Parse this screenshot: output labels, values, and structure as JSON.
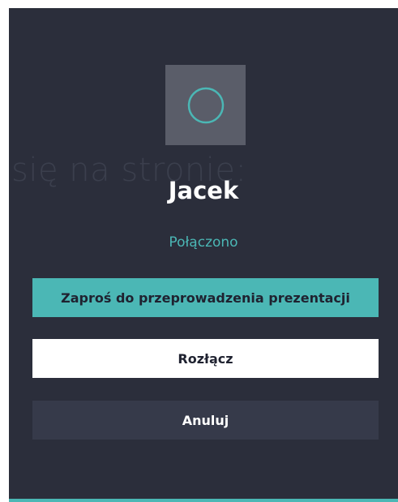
{
  "background_text": "się na stronie:",
  "participant": {
    "name": "Jacek",
    "status": "Połączono",
    "avatar_icon": "circle-icon"
  },
  "actions": {
    "invite_label": "Zaproś do przeprowadzenia prezentacji",
    "disconnect_label": "Rozłącz",
    "cancel_label": "Anuluj"
  },
  "colors": {
    "panel_bg": "#2b2e3b",
    "accent": "#4bb7b5",
    "avatar_bg": "#5a5d69",
    "cancel_bg": "#363a4a"
  }
}
